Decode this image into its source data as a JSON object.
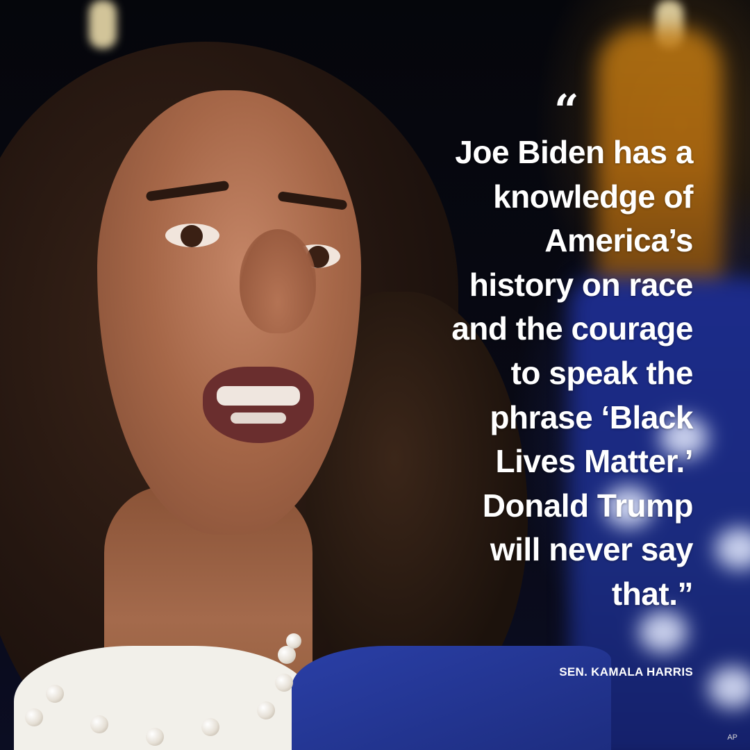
{
  "quote": {
    "open_mark": "“",
    "lines": [
      "Joe Biden has a",
      "knowledge of",
      "America’s",
      "history on race",
      "and the courage",
      "to speak the",
      "phrase ‘Black",
      "Lives Matter.’",
      "Donald Trump",
      "will never say",
      "that.”"
    ]
  },
  "attribution": "SEN. KAMALA HARRIS",
  "photo_credit": "AP",
  "colors": {
    "background": "#070811",
    "text": "#ffffff",
    "flag_blue": "#1c2b8a",
    "flag_gold": "#c07a12",
    "jacket_blue": "#2a3fa6"
  }
}
